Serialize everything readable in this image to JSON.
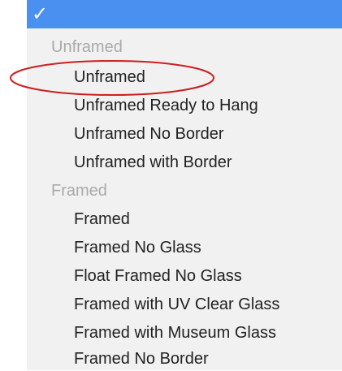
{
  "menu": {
    "selected_check": "✓",
    "groups": [
      {
        "label": "Unframed",
        "options": [
          "Unframed",
          "Unframed Ready to Hang",
          "Unframed No Border",
          "Unframed with Border"
        ]
      },
      {
        "label": "Framed",
        "options": [
          "Framed",
          "Framed No Glass",
          "Float Framed No Glass",
          "Framed with UV Clear Glass",
          "Framed with Museum Glass",
          "Framed No Border"
        ]
      }
    ]
  },
  "colors": {
    "highlight": "#4a90f0",
    "menu_bg": "#f1f1f1",
    "group_label": "#aaaaaa",
    "option_text": "#222222",
    "annotation_circle": "#cc1f1f"
  }
}
